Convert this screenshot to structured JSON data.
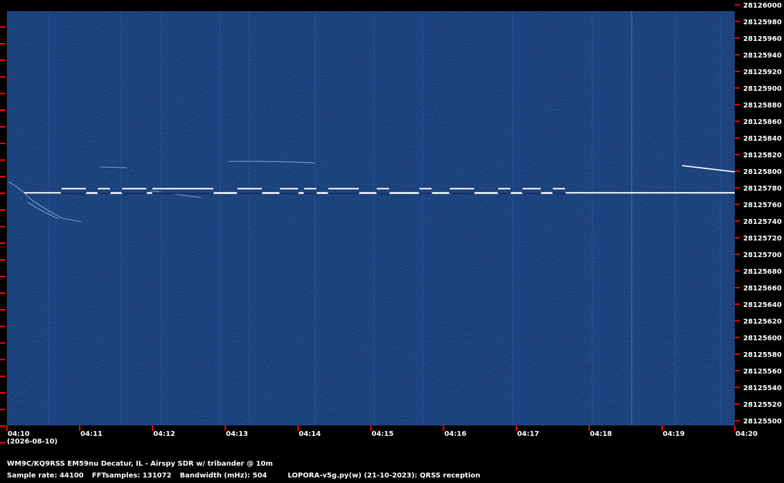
{
  "chart_data": {
    "type": "heatmap",
    "title": "",
    "xlabel": "",
    "ylabel": "",
    "x_ticks": [
      "04:10",
      "04:11",
      "04:12",
      "04:13",
      "04:14",
      "04:15",
      "04:16",
      "04:17",
      "04:18",
      "04:19",
      "04:20"
    ],
    "y_ticks": [
      "28126000",
      "28125980",
      "28125960",
      "28125940",
      "28125920",
      "28125900",
      "28125880",
      "28125860",
      "28125840",
      "28125820",
      "28125800",
      "28125780",
      "28125760",
      "28125740",
      "28125720",
      "28125700",
      "28125680",
      "28125660",
      "28125640",
      "28125620",
      "28125600",
      "28125580",
      "28125560",
      "28125540",
      "28125520",
      "28125500"
    ],
    "y_range": [
      28125500,
      28126000
    ],
    "x_range": [
      "04:10",
      "04:20"
    ],
    "signal": {
      "base_frequency": 28125774,
      "shift_hz": 5,
      "end_time": "04:17:50",
      "high_segments": [
        [
          "04:10:45",
          "04:11:05"
        ],
        [
          "04:11:15",
          "04:11:25"
        ],
        [
          "04:11:35",
          "04:11:55"
        ],
        [
          "04:12:00",
          "04:12:50"
        ],
        [
          "04:13:10",
          "04:13:30"
        ],
        [
          "04:13:45",
          "04:14:00"
        ],
        [
          "04:14:05",
          "04:14:15"
        ],
        [
          "04:14:25",
          "04:14:50"
        ],
        [
          "04:15:05",
          "04:15:15"
        ],
        [
          "04:15:40",
          "04:15:50"
        ],
        [
          "04:16:05",
          "04:16:25"
        ],
        [
          "04:16:45",
          "04:16:55"
        ],
        [
          "04:17:05",
          "04:17:20"
        ],
        [
          "04:17:30",
          "04:17:40"
        ]
      ]
    },
    "colors": {
      "background": "#10306a",
      "signal": "#ffffff",
      "tick": "#ff0000",
      "stripe": "#2a5aa0"
    }
  },
  "date": "(2026-08-10)",
  "station": "WM9C/KQ9RSS EM59nu Decatur, IL - Airspy SDR w/ tribander @ 10m",
  "params": {
    "sample_rate": "Sample rate: 44100",
    "fft_samples": "FFTsamples: 131072",
    "bandwidth": "Bandwidth (mHz): 504",
    "software": "LOPORA-v5g.py(w) (21-10-2023): QRSS reception"
  }
}
